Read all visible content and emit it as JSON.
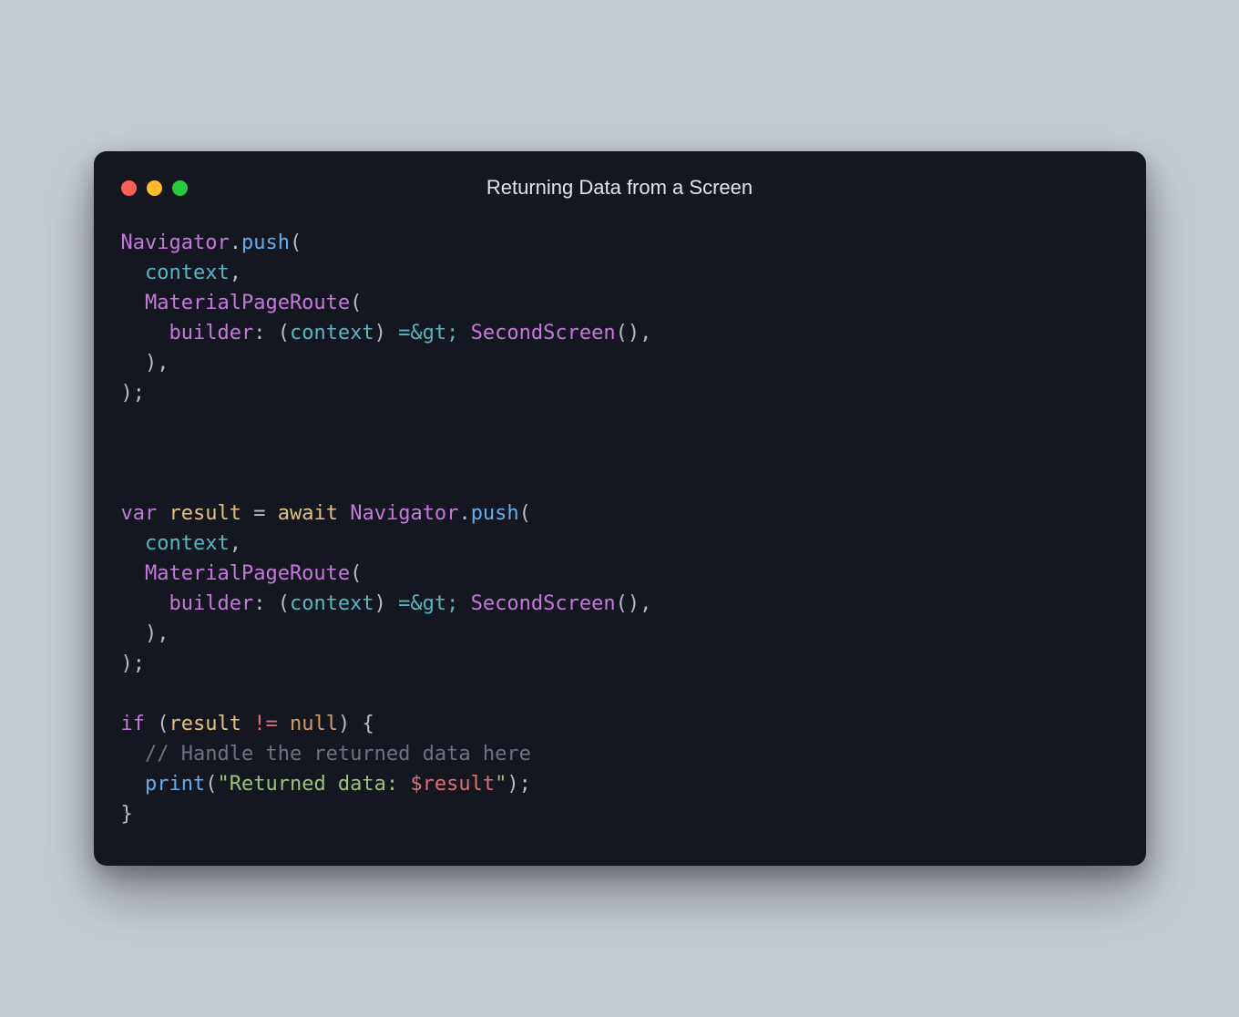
{
  "window": {
    "title": "Returning Data from a Screen"
  },
  "code": {
    "t": {
      "navigator": "Navigator",
      "push": "push",
      "context": "context",
      "materialPageRoute": "MaterialPageRoute",
      "builder": "builder",
      "arrowGt": "=&gt;",
      "secondScreen": "SecondScreen",
      "var": "var",
      "result": "result",
      "await": "await",
      "if": "if",
      "neq": "!=",
      "null": "null",
      "comment": "// Handle the returned data here",
      "print": "print",
      "strOpen": "\"Returned data: ",
      "interp": "$result",
      "strClose": "\""
    },
    "p": {
      "dot": ".",
      "lparen": "(",
      "rparen": ")",
      "comma": ",",
      "colon": ":",
      "semi": ";",
      "eq": "=",
      "lbrace": "{",
      "rbrace": "}"
    }
  }
}
